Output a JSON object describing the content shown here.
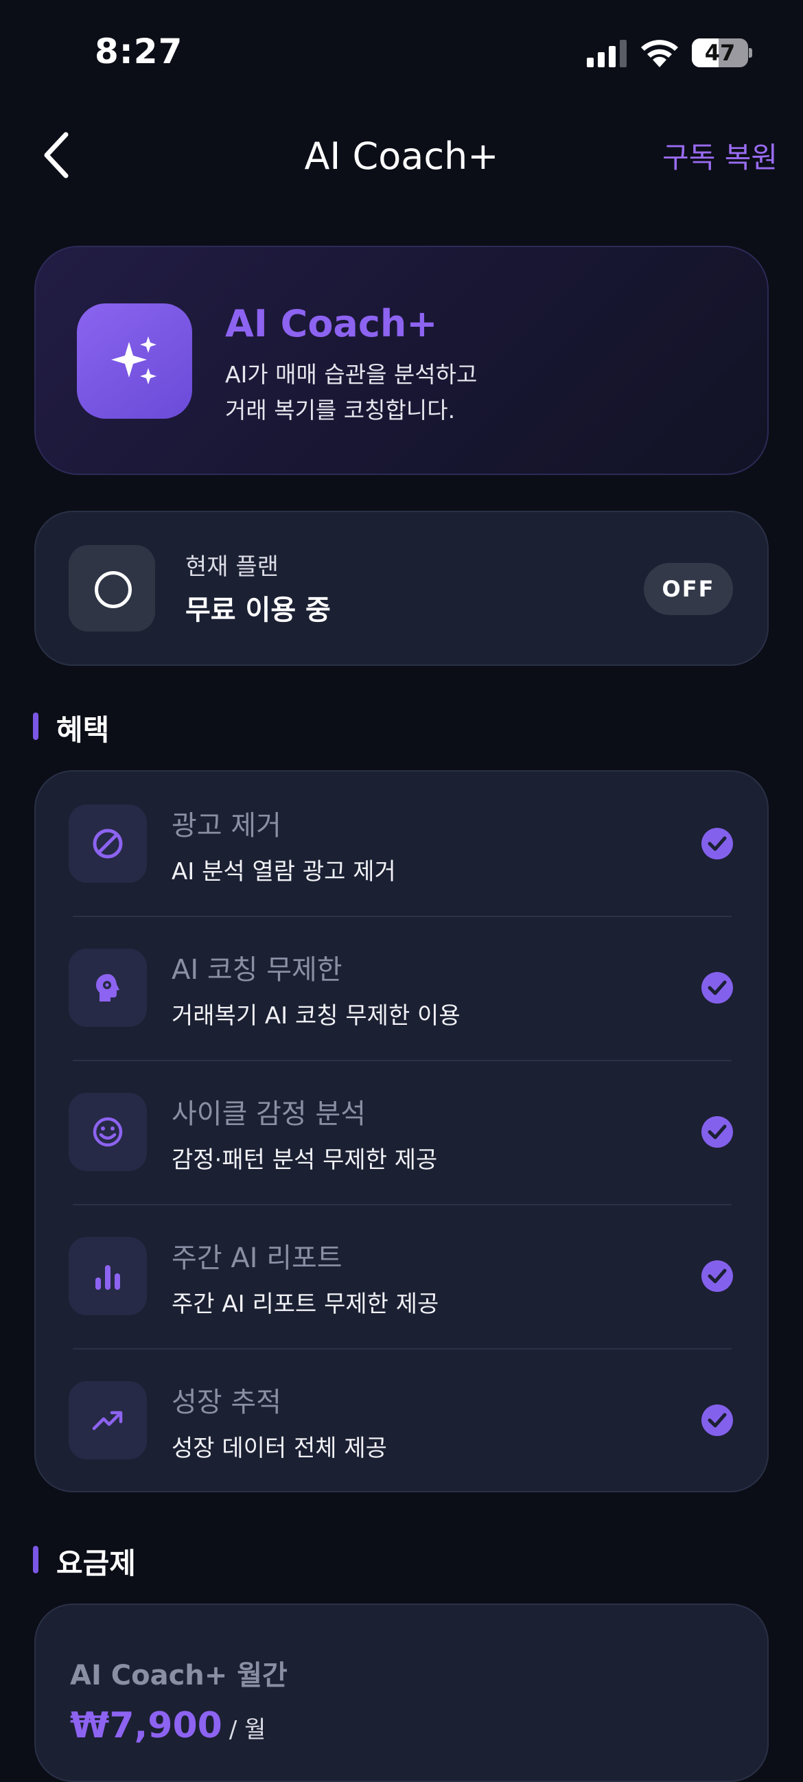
{
  "status_bar": {
    "time": "8:27",
    "battery": "47",
    "battery_level": 0.47
  },
  "nav": {
    "title": "AI Coach+",
    "restore_label": "구독 복원"
  },
  "hero": {
    "title": "AI Coach+",
    "desc_line1": "AI가 매매 습관을 분석하고",
    "desc_line2": "거래 복기를 코칭합니다."
  },
  "plan": {
    "label": "현재 플랜",
    "value": "무료 이용 중",
    "badge": "OFF"
  },
  "benefits": {
    "heading": "혜택",
    "items": [
      {
        "icon": "block-icon",
        "title": "광고 제거",
        "desc": "AI 분석 열람 광고 제거"
      },
      {
        "icon": "brain-gear-icon",
        "title": "AI 코칭 무제한",
        "desc": "거래복기 AI 코칭 무제한 이용"
      },
      {
        "icon": "smiley-icon",
        "title": "사이클 감정 분석",
        "desc": "감정·패턴 분석 무제한 제공"
      },
      {
        "icon": "bar-chart-icon",
        "title": "주간 AI 리포트",
        "desc": "주간 AI 리포트 무제한 제공"
      },
      {
        "icon": "trending-up-icon",
        "title": "성장 추적",
        "desc": "성장 데이터 전체 제공"
      }
    ]
  },
  "pricing": {
    "heading": "요금제",
    "plan_name": "AI Coach+ 월간",
    "price": "₩7,900",
    "period": "/ 월"
  },
  "colors": {
    "accent": "#8d63f1",
    "background": "#0b0e17",
    "card": "#1b2033"
  }
}
